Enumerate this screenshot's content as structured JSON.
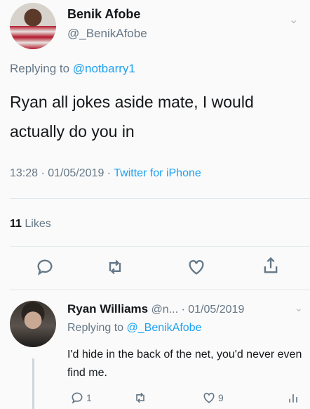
{
  "main_tweet": {
    "display_name": "Benik Afobe",
    "handle": "@_BenikAfobe",
    "replying_prefix": "Replying to",
    "replying_to": "@notbarry1",
    "text": "Ryan all jokes aside mate, I would actually do you in",
    "time": "13:28 · 01/05/2019 ·",
    "source": "Twitter for iPhone",
    "likes_count": "11",
    "likes_label": "Likes"
  },
  "reply_tweet": {
    "display_name": "Ryan Williams",
    "handle_date": "@n... · 01/05/2019",
    "replying_prefix": "Replying to",
    "replying_to": "@_BenikAfobe",
    "text": "I'd hide in the back of the net, you'd never even find me.",
    "reply_count": "1",
    "like_count": "9"
  },
  "colors": {
    "link": "#1da1f2",
    "muted": "#657786",
    "divider": "#e1e8ed"
  },
  "icons": [
    "chevron-down-icon",
    "reply-icon",
    "retweet-icon",
    "like-icon",
    "share-icon",
    "analytics-icon"
  ]
}
